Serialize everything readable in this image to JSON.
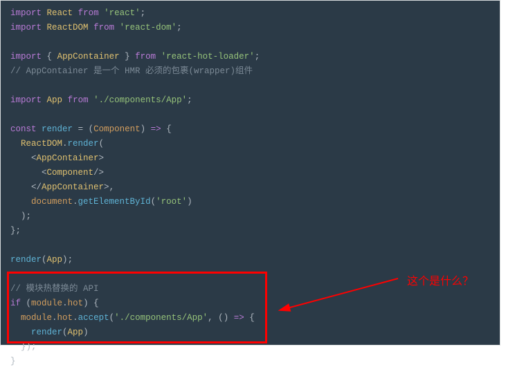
{
  "code": {
    "l1_import": "import",
    "l1_react": "React",
    "l1_from": "from",
    "l1_str": "'react'",
    "l2_import": "import",
    "l2_reactdom": "ReactDOM",
    "l2_from": "from",
    "l2_str": "'react-dom'",
    "l4_import": "import",
    "l4_brace_open": "{",
    "l4_appcontainer": "AppContainer",
    "l4_brace_close": "}",
    "l4_from": "from",
    "l4_str": "'react-hot-loader'",
    "l5_cmt": "// AppContainer 是一个 HMR 必须的包裹(wrapper)组件",
    "l7_import": "import",
    "l7_app": "App",
    "l7_from": "from",
    "l7_str": "'./components/App'",
    "l9_const": "const",
    "l9_render": "render",
    "l9_eq": "=",
    "l9_paren_open": "(",
    "l9_component": "Component",
    "l9_paren_close": ")",
    "l9_arrow": "=>",
    "l9_brace": "{",
    "l10_reactdom": "ReactDOM",
    "l10_dot": ".",
    "l10_render": "render",
    "l10_paren": "(",
    "l11_tag_open": "<",
    "l11_tag": "AppContainer",
    "l11_tag_close": ">",
    "l12_tag_open": "<",
    "l12_tag": "Component",
    "l12_tag_close": "/>",
    "l13_tag_open": "</",
    "l13_tag": "AppContainer",
    "l13_tag_close": ">",
    "l13_comma": ",",
    "l14_document": "document",
    "l14_dot": ".",
    "l14_getelem": "getElementById",
    "l14_paren_open": "(",
    "l14_str": "'root'",
    "l14_paren_close": ")",
    "l15_paren": ")",
    "l15_semi": ";",
    "l16_brace": "}",
    "l16_semi": ";",
    "l18_render": "render",
    "l18_paren_open": "(",
    "l18_app": "App",
    "l18_paren_close": ")",
    "l18_semi": ";",
    "l20_cmt": "// 模块热替换的 API",
    "l21_if": "if",
    "l21_paren_open": "(",
    "l21_module": "module",
    "l21_dot": ".",
    "l21_hot": "hot",
    "l21_paren_close": ")",
    "l21_brace": "{",
    "l22_module": "module",
    "l22_dot1": ".",
    "l22_hot": "hot",
    "l22_dot2": ".",
    "l22_accept": "accept",
    "l22_paren_open": "(",
    "l22_str": "'./components/App'",
    "l22_comma": ",",
    "l22_paren2_open": "(",
    "l22_paren2_close": ")",
    "l22_arrow": "=>",
    "l22_brace": "{",
    "l23_render": "render",
    "l23_paren_open": "(",
    "l23_app": "App",
    "l23_paren_close": ")",
    "l24_brace": "}",
    "l24_paren": ")",
    "l24_semi": ";",
    "l25_brace": "}"
  },
  "annotation": {
    "text": "这个是什么？"
  }
}
